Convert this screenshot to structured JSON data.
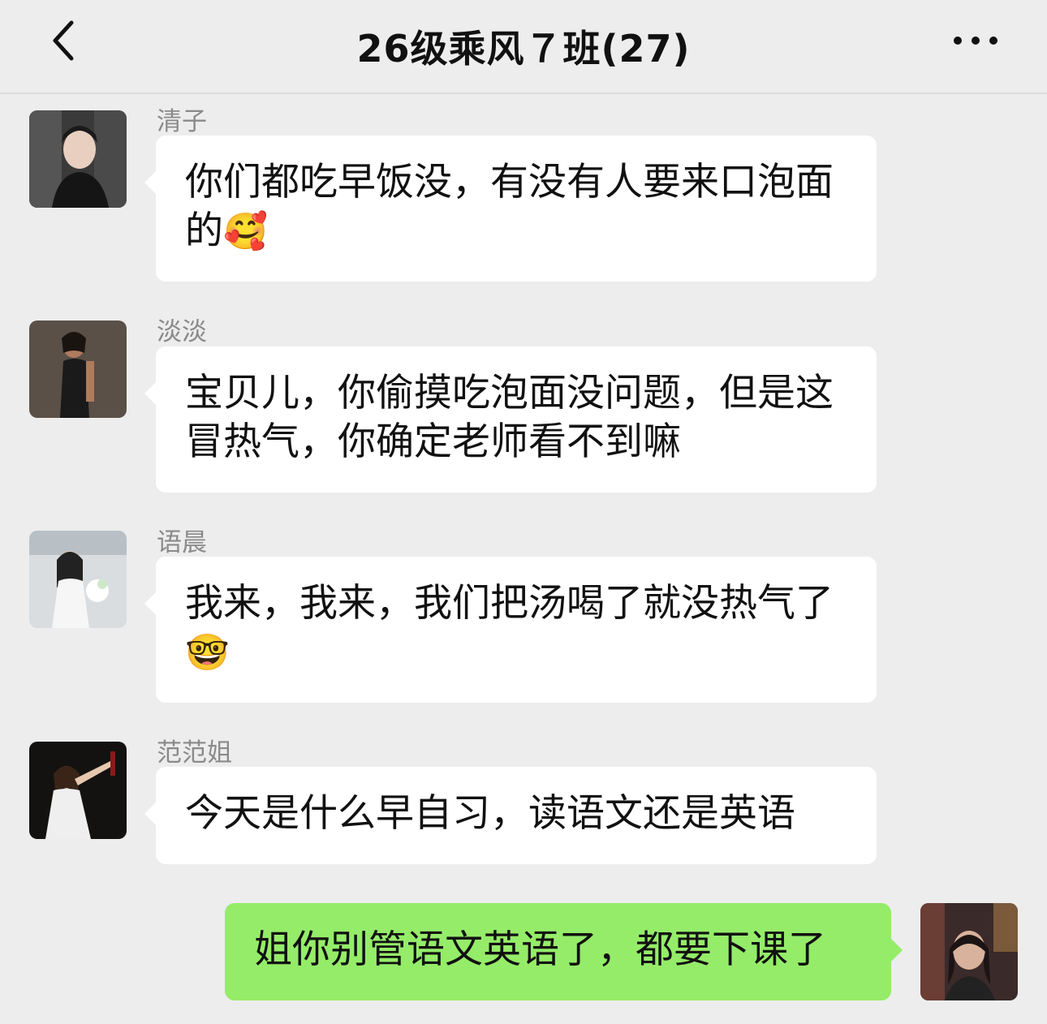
{
  "header": {
    "title": "26级乘风７班(27)",
    "back_icon": "chevron-left-icon",
    "more_icon": "more-dots-icon"
  },
  "messages": [
    {
      "sender": "清子",
      "text": "你们都吃早饭没，有没有人要来口泡面的",
      "emoji": "🥰"
    },
    {
      "sender": "淡淡",
      "text": "宝贝儿，你偷摸吃泡面没问题，但是这冒热气，你确定老师看不到嘛",
      "emoji": ""
    },
    {
      "sender": "语晨",
      "text": "我来，我来，我们把汤喝了就没热气了",
      "emoji": "🤓"
    },
    {
      "sender": "范范姐",
      "text": "今天是什么早自习，读语文还是英语",
      "emoji": ""
    },
    {
      "sender": "",
      "text": "姐你别管语文英语了，都要下课了",
      "emoji": "",
      "mine": true
    }
  ],
  "colors": {
    "background": "#ededed",
    "bubble_other": "#ffffff",
    "bubble_mine": "#95ec69"
  }
}
